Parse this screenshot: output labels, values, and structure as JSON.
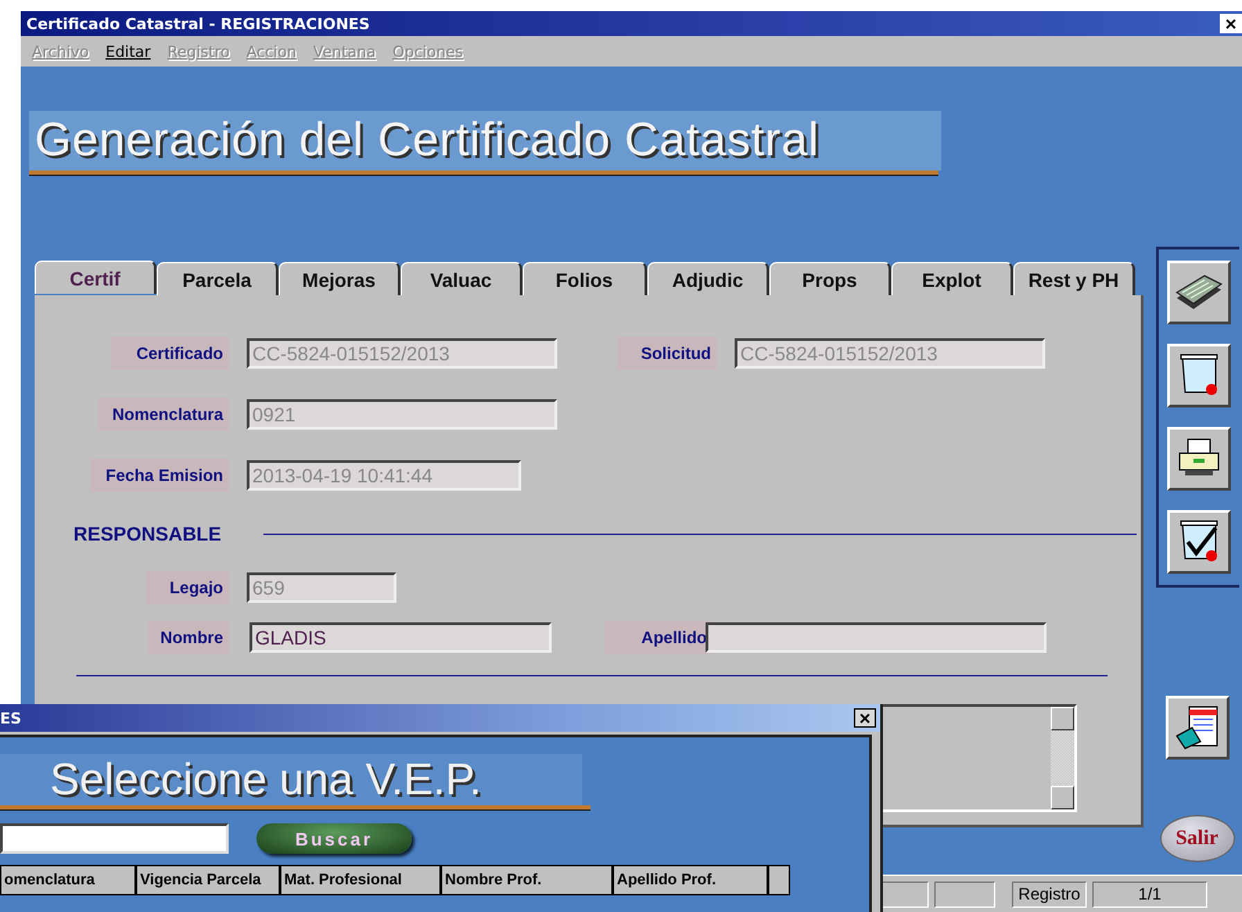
{
  "window": {
    "title": "Certificado Catastral - REGISTRACIONES",
    "close": "×"
  },
  "menu": [
    {
      "label": "Archivo",
      "disabled": true
    },
    {
      "label": "Editar",
      "disabled": false
    },
    {
      "label": "Registro",
      "disabled": true
    },
    {
      "label": "Accion",
      "disabled": true
    },
    {
      "label": "Ventana",
      "disabled": true
    },
    {
      "label": "Opciones",
      "disabled": true
    }
  ],
  "heading": "Generación del Certificado Catastral",
  "tabs": [
    {
      "label": "Certif",
      "selected": true
    },
    {
      "label": "Parcela",
      "selected": false
    },
    {
      "label": "Mejoras",
      "selected": false
    },
    {
      "label": "Valuac",
      "selected": false
    },
    {
      "label": "Folios",
      "selected": false
    },
    {
      "label": "Adjudic",
      "selected": false
    },
    {
      "label": "Props",
      "selected": false
    },
    {
      "label": "Explot",
      "selected": false
    },
    {
      "label": "Rest y PH",
      "selected": false
    }
  ],
  "certificate": {
    "certificado": {
      "label": "Certificado",
      "value": "CC-5824-015152/2013"
    },
    "solicitud": {
      "label": "Solicitud",
      "value": "CC-5824-015152/2013"
    },
    "nomenclatura": {
      "label": "Nomenclatura",
      "value": "0921"
    },
    "fecha_emision": {
      "label": "Fecha Emision",
      "value": "2013-04-19 10:41:44"
    }
  },
  "responsable": {
    "title": "RESPONSABLE",
    "legajo": {
      "label": "Legajo",
      "value": "659"
    },
    "nombre": {
      "label": "Nombre",
      "value": "GLADIS"
    },
    "apellido": {
      "label": "Apellido"
    }
  },
  "exit_button": "Salir",
  "status_bar": {
    "label": "Registro",
    "value": "1/1"
  },
  "dialog": {
    "title": "ES",
    "close": "×",
    "heading": "Seleccione una V.E.P.",
    "search_button": "Buscar",
    "columns": [
      "omenclatura",
      "Vigencia Parcela",
      "Mat. Profesional",
      "Nombre Prof.",
      "Apellido Prof."
    ]
  }
}
